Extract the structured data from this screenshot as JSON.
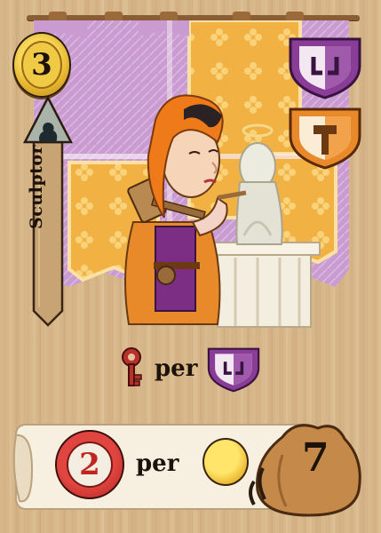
{
  "card": {
    "cost": "3",
    "role_name": "Sculptor",
    "bonus_word": "per",
    "scroll_token_value": "2",
    "scroll_word": "per",
    "scroll_count": "7"
  },
  "colors": {
    "tapestry_purple": "#c79bcf",
    "tapestry_orange": "#f1b143",
    "shield_purple": "#8a3d97",
    "shield_orange": "#e8892a",
    "token_red": "#c12a24",
    "coin_gold": "#f0c640"
  },
  "icons": [
    "coin-icon",
    "statue-silhouette-icon",
    "purple-guild-shield-icon",
    "orange-guild-shield-icon",
    "hammer-icon",
    "key-icon",
    "red-token-icon",
    "gold-coin-icon",
    "sack-icon"
  ]
}
